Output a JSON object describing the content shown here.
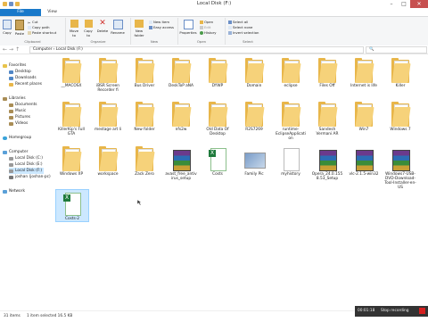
{
  "window": {
    "title": "Local Disk (F:)"
  },
  "ribbon_tabs": [
    "File",
    "Home",
    "Share",
    "View"
  ],
  "ribbon": {
    "clipboard": {
      "label": "Clipboard",
      "copy": "Copy",
      "paste": "Paste",
      "cut": "Cut",
      "copy_path": "Copy path",
      "paste_shortcut": "Paste shortcut"
    },
    "organize": {
      "label": "Organize",
      "move_to": "Move to",
      "copy_to": "Copy to",
      "delete": "Delete",
      "rename": "Rename"
    },
    "new": {
      "label": "New",
      "new_folder": "New folder",
      "new_item": "New item",
      "easy_access": "Easy access"
    },
    "open": {
      "label": "Open",
      "properties": "Properties",
      "open": "Open",
      "edit": "Edit",
      "history": "History"
    },
    "select": {
      "label": "Select",
      "select_all": "Select all",
      "select_none": "Select none",
      "invert_selection": "Invert selection"
    }
  },
  "navigation": {
    "path": "Computer › Local Disk (F:)"
  },
  "sidebar": {
    "items": [
      {
        "label": "Favorites"
      },
      {
        "label": "Desktop"
      },
      {
        "label": "Downloads"
      },
      {
        "label": "Recent places"
      },
      {
        "label": "Libraries"
      },
      {
        "label": "Documents"
      },
      {
        "label": "Music"
      },
      {
        "label": "Pictures"
      },
      {
        "label": "Videos"
      },
      {
        "label": "Homegroup"
      },
      {
        "label": "Computer"
      },
      {
        "label": "Local Disk (C:)"
      },
      {
        "label": "Local Disk (E:)"
      },
      {
        "label": "Local Disk (F:)"
      },
      {
        "label": "joshan (joshan-pc)"
      },
      {
        "label": "Network"
      }
    ]
  },
  "files": [
    {
      "label": "__MACOSX",
      "type": "folder"
    },
    {
      "label": "iBSR Screen Recorder fi",
      "type": "folder"
    },
    {
      "label": "Bus Driver",
      "type": "folder"
    },
    {
      "label": "DeskToP aNA",
      "type": "folder"
    },
    {
      "label": "DYWP",
      "type": "folder"
    },
    {
      "label": "Domain",
      "type": "folder"
    },
    {
      "label": "eclipse",
      "type": "folder"
    },
    {
      "label": "Files Off",
      "type": "folder"
    },
    {
      "label": "Internet is life",
      "type": "folder"
    },
    {
      "label": "Killer",
      "type": "folder"
    },
    {
      "label": "KillerKip's Full GTA",
      "type": "folder"
    },
    {
      "label": "mestage art li",
      "type": "folder"
    },
    {
      "label": "New folder",
      "type": "folder"
    },
    {
      "label": "nfs2w",
      "type": "folder"
    },
    {
      "label": "Old Data Of Desktop",
      "type": "folder"
    },
    {
      "label": "R2S7269",
      "type": "folder"
    },
    {
      "label": "runtime-EclipseApplication",
      "type": "folder"
    },
    {
      "label": "Sandesh Vermani AR",
      "type": "folder"
    },
    {
      "label": "Win7",
      "type": "folder"
    },
    {
      "label": "Windows 7",
      "type": "folder"
    },
    {
      "label": "Windows XP",
      "type": "folder"
    },
    {
      "label": "workspace",
      "type": "folder"
    },
    {
      "label": "Zack Zero",
      "type": "folder"
    },
    {
      "label": "avast_free_antivirus_setup",
      "type": "archive"
    },
    {
      "label": "Costs",
      "type": "excel"
    },
    {
      "label": "Family Pic",
      "type": "image"
    },
    {
      "label": "myhistory",
      "type": "text"
    },
    {
      "label": "Opera_24.0.1558.53_Setup",
      "type": "archive"
    },
    {
      "label": "vlc-2.1.5-win32",
      "type": "archive"
    },
    {
      "label": "Windows7-USB-DVD-Download-Tool-Installer-en-US",
      "type": "archive"
    },
    {
      "label": "Costs-2",
      "type": "excel"
    }
  ],
  "status": {
    "item_count": "31 items",
    "selection": "1 item selected  16.5 KB"
  },
  "recorder": {
    "time": "00:01:18",
    "stop_label": "Stop recording"
  },
  "colors": {
    "folder": "#e8b64a",
    "file_tab": "#1979ca",
    "selection": "#cce8ff"
  }
}
